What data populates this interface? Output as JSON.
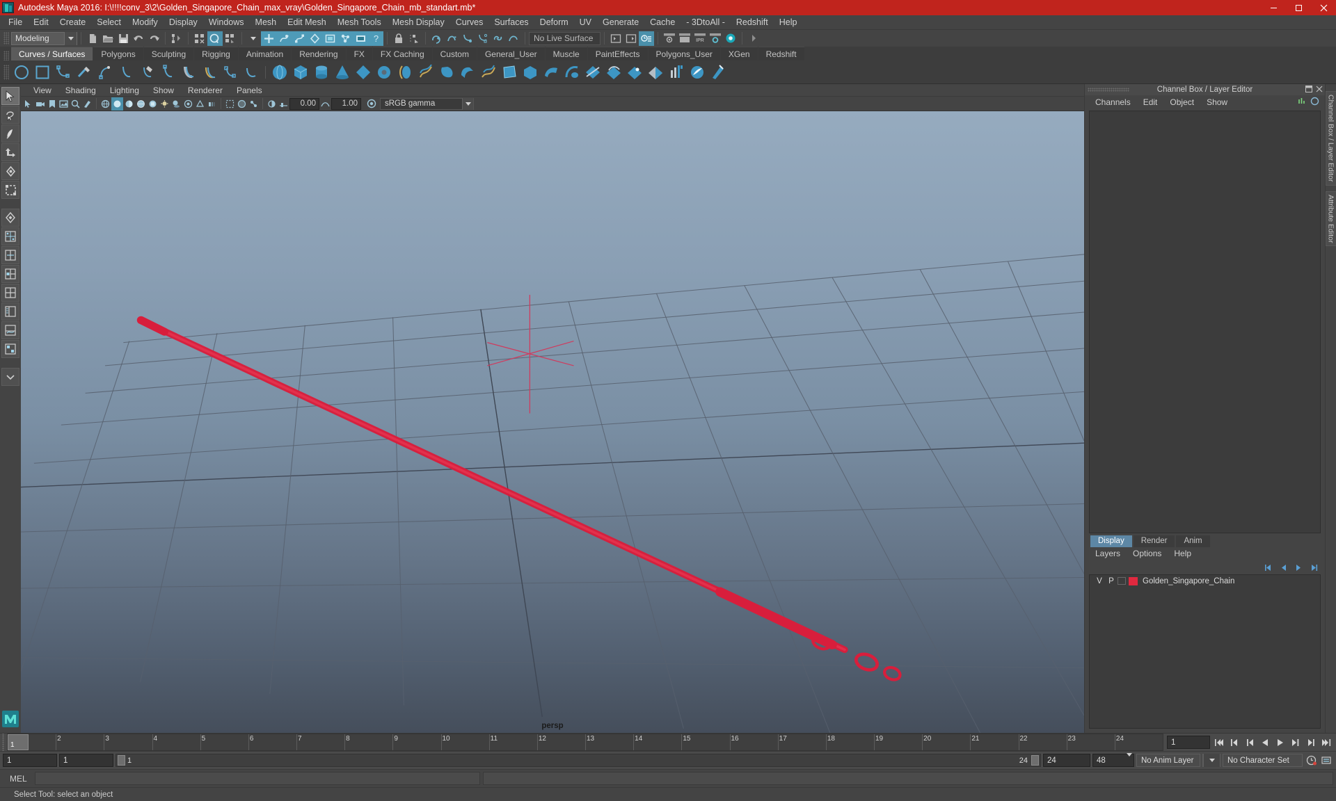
{
  "titlebar": {
    "title": "Autodesk Maya 2016: I:\\!!!!conv_3\\2\\Golden_Singapore_Chain_max_vray\\Golden_Singapore_Chain_mb_standart.mb*",
    "app_icon": "maya-icon",
    "minimize": "–",
    "maximize": "❐",
    "close": "✕",
    "bg_color": "#c0241d"
  },
  "menubar": {
    "items": [
      "File",
      "Edit",
      "Create",
      "Select",
      "Modify",
      "Display",
      "Windows",
      "Mesh",
      "Edit Mesh",
      "Mesh Tools",
      "Mesh Display",
      "Curves",
      "Surfaces",
      "Deform",
      "UV",
      "Generate",
      "Cache",
      "- 3DtoAll -",
      "Redshift",
      "Help"
    ]
  },
  "statusline": {
    "mode": "Modeling",
    "live_surface": "No Live Surface"
  },
  "shelf": {
    "tabs": [
      "Curves / Surfaces",
      "Polygons",
      "Sculpting",
      "Rigging",
      "Animation",
      "Rendering",
      "FX",
      "FX Caching",
      "Custom",
      "General_User",
      "Muscle",
      "PaintEffects",
      "Polygons_User",
      "XGen",
      "Redshift"
    ],
    "active_tab": "Curves / Surfaces"
  },
  "panel": {
    "menus": [
      "View",
      "Shading",
      "Lighting",
      "Show",
      "Renderer",
      "Panels"
    ],
    "exposure": "0.00",
    "gamma_value": "1.00",
    "color_profile": "sRGB gamma",
    "camera_label": "persp"
  },
  "viewport": {
    "object_color": "#d81e3c",
    "grid_color": "#5a6270",
    "axis_color": "#cf3b5e",
    "bg_top": "#93a8bd",
    "bg_bottom": "#464f5c"
  },
  "channelbox": {
    "title": "Channel Box / Layer Editor",
    "menus": [
      "Channels",
      "Edit",
      "Object",
      "Show"
    ]
  },
  "layereditor": {
    "tabs": [
      "Display",
      "Render",
      "Anim"
    ],
    "active_tab": "Display",
    "menus": [
      "Layers",
      "Options",
      "Help"
    ],
    "columns": [
      "V",
      "P"
    ],
    "layers": [
      {
        "visible": "",
        "playback": "",
        "color": "#e0293f",
        "name": "Golden_Singapore_Chain"
      }
    ]
  },
  "timeline": {
    "ticks": [
      "1",
      "2",
      "3",
      "4",
      "5",
      "6",
      "7",
      "8",
      "9",
      "10",
      "11",
      "12",
      "13",
      "14",
      "15",
      "16",
      "17",
      "18",
      "19",
      "20",
      "21",
      "22",
      "23",
      "24"
    ],
    "current_frame": "1",
    "current_frame_field": "1",
    "range_start": "1",
    "range_end": "1",
    "playback_start": "1",
    "playback_end": "24",
    "anim_end": "24",
    "anim_total": "48",
    "anim_layer": "No Anim Layer",
    "character_set": "No Character Set"
  },
  "commandline": {
    "label": "MEL",
    "value": "",
    "output": ""
  },
  "helpline": {
    "text": "Select Tool: select an object"
  },
  "righttabs": [
    "Channel Box / Layer Editor",
    "Attribute Editor"
  ]
}
